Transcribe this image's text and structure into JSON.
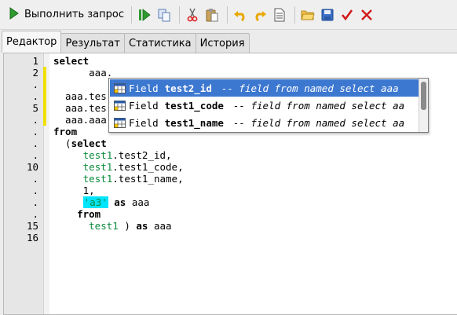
{
  "toolbar": {
    "run_label": "Выполнить запрос",
    "icons": [
      "run-icon",
      "run-step-icon",
      "copy-icon",
      "cut-icon",
      "paste-icon",
      "undo-icon",
      "redo-icon",
      "document-icon",
      "open-folder-icon",
      "save-icon",
      "commit-check-icon",
      "rollback-x-icon"
    ]
  },
  "tabs": [
    {
      "label": "Редактор",
      "active": true
    },
    {
      "label": "Результат",
      "active": false
    },
    {
      "label": "Статистика",
      "active": false
    },
    {
      "label": "История",
      "active": false
    }
  ],
  "editor": {
    "line_numbers": [
      "1",
      "2",
      ".",
      ".",
      "5",
      ".",
      ".",
      ".",
      ".",
      "10",
      ".",
      ".",
      ".",
      ".",
      "15",
      "16"
    ],
    "lines": [
      {
        "parts": [
          {
            "t": "select",
            "c": "kw"
          }
        ]
      },
      {
        "parts": [
          {
            "t": "      aaa.",
            "c": ""
          }
        ]
      },
      {
        "parts": []
      },
      {
        "parts": [
          {
            "t": "  aaa.tes",
            "c": ""
          }
        ]
      },
      {
        "parts": [
          {
            "t": "  aaa.tes",
            "c": ""
          }
        ]
      },
      {
        "parts": [
          {
            "t": "  aaa.aaa",
            "c": ""
          }
        ]
      },
      {
        "parts": [
          {
            "t": "from",
            "c": "kw"
          }
        ]
      },
      {
        "parts": [
          {
            "t": "  (",
            "c": ""
          },
          {
            "t": "select",
            "c": "kw"
          }
        ]
      },
      {
        "parts": [
          {
            "t": "     ",
            "c": ""
          },
          {
            "t": "test1",
            "c": "id"
          },
          {
            "t": ".test2_id,",
            "c": ""
          }
        ]
      },
      {
        "parts": [
          {
            "t": "     ",
            "c": ""
          },
          {
            "t": "test1",
            "c": "id"
          },
          {
            "t": ".test1_code,",
            "c": ""
          }
        ]
      },
      {
        "parts": [
          {
            "t": "     ",
            "c": ""
          },
          {
            "t": "test1",
            "c": "id"
          },
          {
            "t": ".test1_name,",
            "c": ""
          }
        ]
      },
      {
        "parts": [
          {
            "t": "     1,",
            "c": ""
          }
        ]
      },
      {
        "parts": [
          {
            "t": "     ",
            "c": ""
          },
          {
            "t": "'a3'",
            "c": "str"
          },
          {
            "t": " ",
            "c": ""
          },
          {
            "t": "as",
            "c": "kw"
          },
          {
            "t": " aaa",
            "c": ""
          }
        ]
      },
      {
        "parts": [
          {
            "t": "    ",
            "c": ""
          },
          {
            "t": "from",
            "c": "kw"
          }
        ]
      },
      {
        "parts": [
          {
            "t": "      ",
            "c": ""
          },
          {
            "t": "test1",
            "c": "id"
          },
          {
            "t": " ) ",
            "c": ""
          },
          {
            "t": "as",
            "c": "kw"
          },
          {
            "t": " aaa",
            "c": ""
          }
        ]
      },
      {
        "parts": []
      }
    ],
    "changed_lines": [
      2,
      3,
      4,
      5,
      6
    ]
  },
  "autocomplete": {
    "items": [
      {
        "type": "Field",
        "name": "test2_id",
        "desc": "-- field from named select aaa",
        "selected": true
      },
      {
        "type": "Field",
        "name": "test1_code",
        "desc": "-- field from named select aa",
        "selected": false
      },
      {
        "type": "Field",
        "name": "test1_name",
        "desc": "-- field from named select aa",
        "selected": false
      }
    ]
  },
  "colors": {
    "selection": "#3d78d0",
    "identifier": "#0a8a3c",
    "string_highlight": "#00e5ff",
    "change_bar": "#f0e000"
  }
}
